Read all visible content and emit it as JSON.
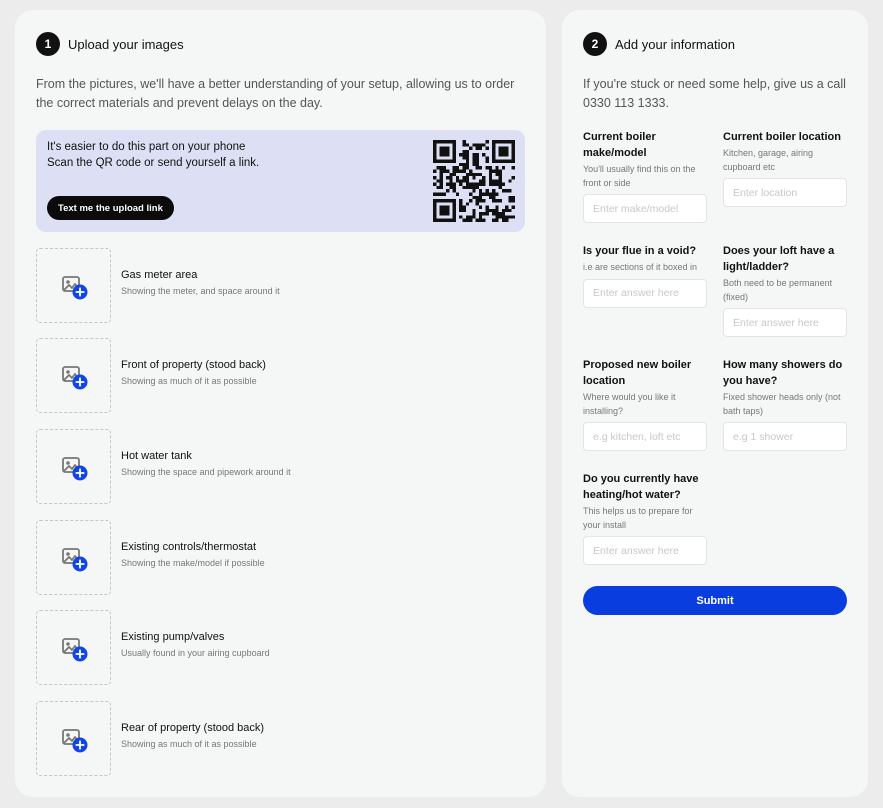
{
  "upload_section": {
    "step_number": "1",
    "title": "Upload your images",
    "intro_lines": [
      "From the pictures, we'll have a better understanding of your setup, allowing us to order",
      "the correct materials and prevent delays on the day."
    ],
    "phone_prompt": {
      "line1": "It's easier to do this part on your phone",
      "line2": "Scan the QR code or send yourself a link.",
      "button_label": "Text me the upload link"
    },
    "items": [
      {
        "title": "Gas meter area",
        "subtitle": "Showing the meter, and space around it"
      },
      {
        "title": "Front of property (stood back)",
        "subtitle": "Showing as much of it as possible"
      },
      {
        "title": "Hot water tank",
        "subtitle": "Showing the space and pipework around it"
      },
      {
        "title": "Existing controls/thermostat",
        "subtitle": "Showing the make/model if possible"
      },
      {
        "title": "Existing pump/valves",
        "subtitle": "Usually found in your airing cupboard"
      },
      {
        "title": "Rear of property (stood back)",
        "subtitle": "Showing as much of it as possible"
      }
    ]
  },
  "info_section": {
    "step_number": "2",
    "title": "Add your information",
    "intro_lines": [
      "If you're stuck or need some help, give us a call",
      "0330 113 1333."
    ],
    "fields": [
      {
        "label": "Current boiler make/model",
        "help": "You'll usually find this on the front or side",
        "placeholder": "Enter make/model",
        "value": ""
      },
      {
        "label": "Current boiler location",
        "help": "Kitchen, garage, airing cupboard etc",
        "placeholder": "Enter location",
        "value": ""
      },
      {
        "label": "Is your flue in a void?",
        "help": "i.e are sections of it boxed in",
        "placeholder": "Enter answer here",
        "value": ""
      },
      {
        "label": "Does your loft have a light/ladder?",
        "help": "Both need to be permanent (fixed)",
        "placeholder": "Enter answer here",
        "value": ""
      },
      {
        "label": "Proposed new boiler location",
        "help": "Where would you like it installing?",
        "placeholder": "e.g kitchen, loft etc",
        "value": ""
      },
      {
        "label": "How many showers do you have?",
        "help": "Fixed shower heads only (not bath taps)",
        "placeholder": "e.g 1 shower",
        "value": ""
      },
      {
        "label": "Do you currently have heating/hot water?",
        "help": "This helps us to prepare for your install",
        "placeholder": "Enter answer here",
        "value": ""
      }
    ],
    "submit_label": "Submit"
  },
  "colors": {
    "page_background": "#ececed",
    "card_background": "#f5f6f6",
    "qr_panel_background": "#dde0f4",
    "primary_button": "#0a3de0",
    "dark_button": "#0b0b0b",
    "add_badge": "#1045e6"
  },
  "icons": {
    "upload_placeholder": "image-add-icon",
    "qr": "qr-code"
  }
}
